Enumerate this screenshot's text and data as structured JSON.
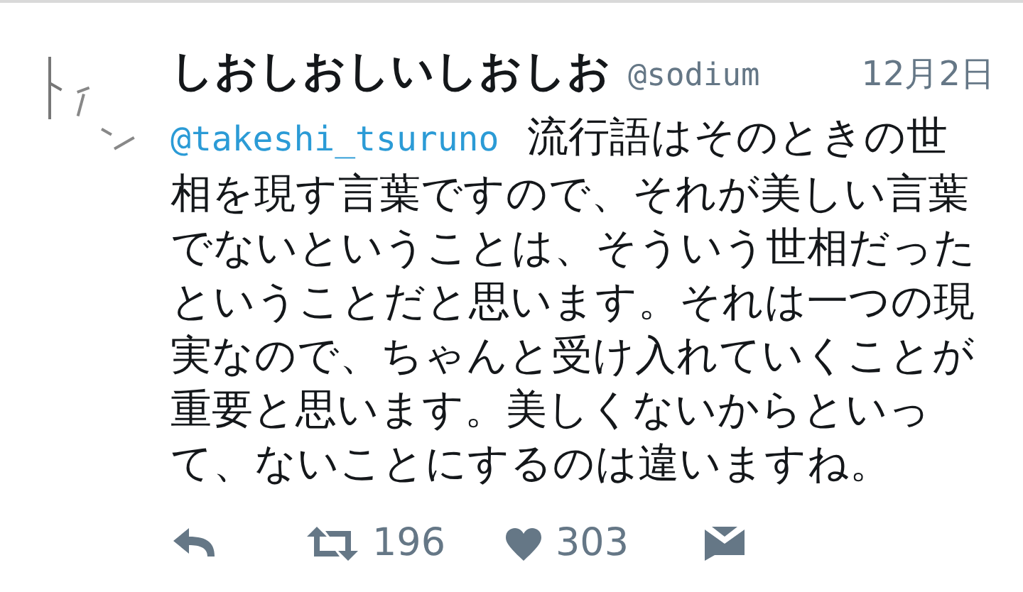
{
  "tweet": {
    "author_name": "しおしおしいしおしお",
    "handle": "@sodium",
    "date": "12月2日",
    "mention": "@takeshi_tsuruno",
    "body": "流行語はそのときの世相を現す言葉ですので、それが美しい言葉でないということは、そういう世相だったということだと思います。それは一つの現実なので、ちゃんと受け入れていくことが重要と思います。美しくないからといって、ないことにするのは違いますね。",
    "actions": [
      {
        "kind": "reply"
      },
      {
        "kind": "retweet",
        "count": "196"
      },
      {
        "kind": "like",
        "count": "303"
      },
      {
        "kind": "message"
      }
    ]
  }
}
